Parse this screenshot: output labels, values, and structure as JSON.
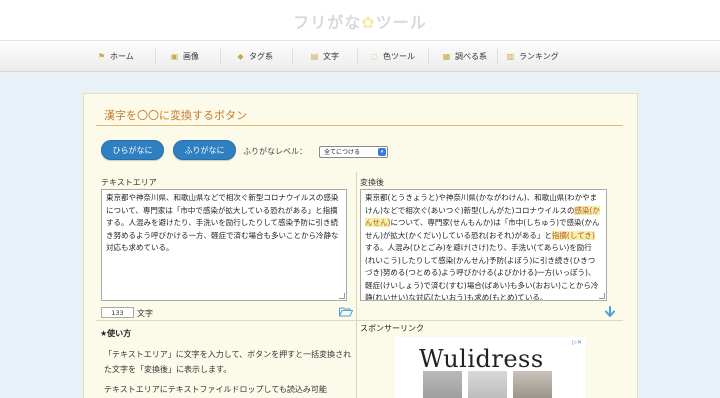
{
  "site": {
    "logo_left": "フリがな",
    "logo_star": "✿",
    "logo_right": "ツール"
  },
  "nav": {
    "items": [
      {
        "label": "ホーム",
        "icon": "flag-icon"
      },
      {
        "label": "画像",
        "icon": "image-icon"
      },
      {
        "label": "タグ系",
        "icon": "tag-icon"
      },
      {
        "label": "文字",
        "icon": "text-icon"
      },
      {
        "label": "色ツール",
        "icon": "color-icon"
      },
      {
        "label": "調べる系",
        "icon": "search-icon"
      },
      {
        "label": "ランキング",
        "icon": "ranking-icon"
      }
    ]
  },
  "main": {
    "title": "漢字を〇〇に変換するボタン",
    "hiragana_button": "ひらがなに",
    "furigana_button": "ふりがなに",
    "level_label": "ふりがなレベル：",
    "level_selected": "全てにつける",
    "text_area_label": "テキストエリア",
    "output_label": "変換後",
    "input_text": "東京都や神奈川県、和歌山県などで相次ぐ新型コロナウイルスの感染について、専門家は「市中で感染が拡大している恐れがある」と指摘する。人混みを避けたり、手洗いを励行したりして感染予防に引き続き努めるよう呼びかける一方、軽症で済む場合も多いことから冷静な対応も求めている。",
    "output_segments": [
      "東京都(とうきょうと)や神奈川県(かながわけん)、和歌山県(わかやまけん)などで相次ぐ(あいつぐ)新型(しんがた)コロナウイルスの",
      "感染(かんせん)",
      "について、専門家(せんもんか)は「市中(しちゅう)で感染(かんせん)が拡大(かくだい)している恐れ(おそれ)がある」と",
      "指摘(してき)",
      "する。人混み(ひとごみ)を避け(さけ)たり、手洗い(てあらい)を励行(れいこう)したりして感染(かんせん)予防(よぼう)に引き続き(ひきつづき)努める(つとめる)よう呼びかける(よびかける)一方(いっぽう)、軽症(けいしょう)で済む(すむ)場合(ばあい)も多い(おおい)ことから冷静(れいせい)な対応(たいおう)も求め(もとめ)ている。"
    ],
    "char_count": "133",
    "char_label": "文字",
    "usage_title": "★使い方",
    "usage_p1": "「テキストエリア」に文字を入力して、ボタンを押すと一括変換された文字を「変換後」に表示します。",
    "usage_p2": "テキストエリアにテキストファイルドロップしても読込み可能",
    "sponsor_title": "スポンサーリンク",
    "ad_brand": "Wulidress"
  },
  "colors": {
    "accent": "#2f7fc3",
    "title": "#c77a2a",
    "highlight": "#f4f1a6"
  }
}
